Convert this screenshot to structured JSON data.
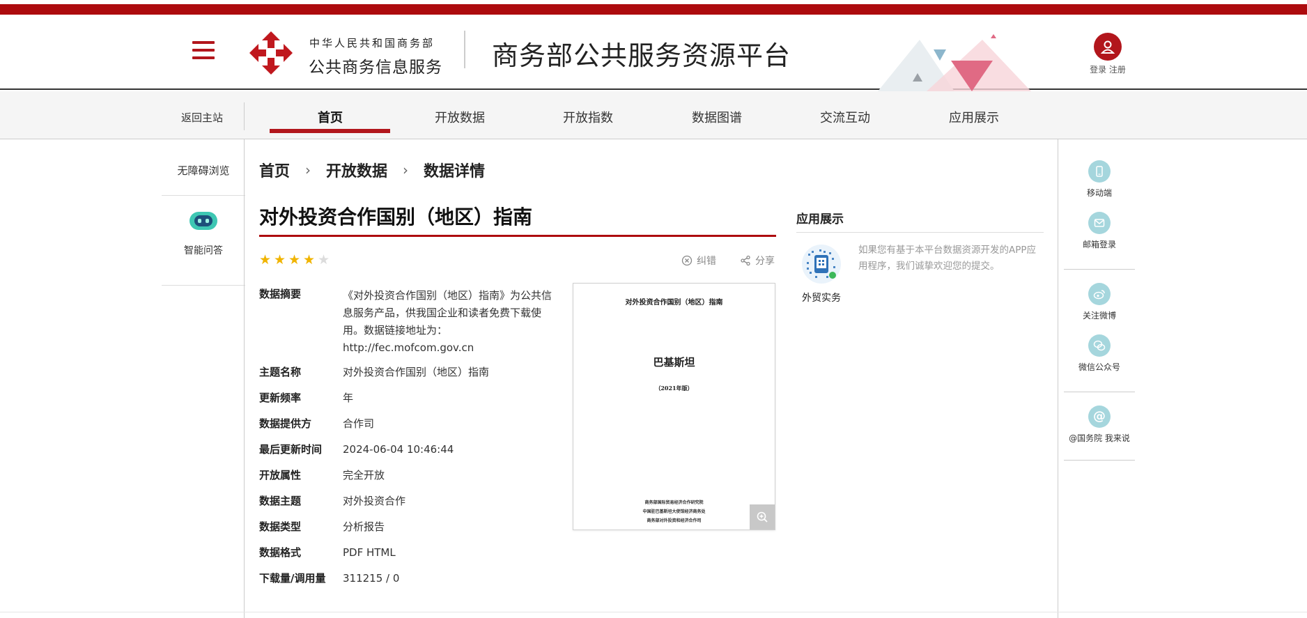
{
  "header": {
    "org_name": "中华人民共和国商务部",
    "org_sub": "公共商务信息服务",
    "platform_title": "商务部公共服务资源平台",
    "login": "登录",
    "register": "注册"
  },
  "nav": {
    "back_home": "返回主站",
    "items": [
      "首页",
      "开放数据",
      "开放指数",
      "数据图谱",
      "交流互动",
      "应用展示"
    ]
  },
  "left_rail": {
    "accessibility": "无障碍浏览",
    "assistant": "智能问答"
  },
  "breadcrumb": [
    "首页",
    "开放数据",
    "数据详情"
  ],
  "dataset": {
    "title": "对外投资合作国别（地区）指南",
    "rating": 4,
    "rating_max": 5,
    "correct_label": "纠错",
    "share_label": "分享",
    "fields": [
      {
        "key": "数据摘要",
        "value": "《对外投资合作国别（地区）指南》为公共信息服务产品，供我国企业和读者免费下载使用。数据链接地址为：http://fec.mofcom.gov.cn"
      },
      {
        "key": "主题名称",
        "value": "对外投资合作国别（地区）指南"
      },
      {
        "key": "更新频率",
        "value": "年"
      },
      {
        "key": "数据提供方",
        "value": "合作司"
      },
      {
        "key": "最后更新时间",
        "value": "2024-06-04 10:46:44"
      },
      {
        "key": "开放属性",
        "value": "完全开放"
      },
      {
        "key": "数据主题",
        "value": "对外投资合作"
      },
      {
        "key": "数据类型",
        "value": "分析报告"
      },
      {
        "key": "数据格式",
        "value": "PDF HTML"
      },
      {
        "key": "下载量/调用量",
        "value": "311215 / 0"
      }
    ]
  },
  "preview": {
    "head": "对外投资合作国别（地区）指南",
    "country": "巴基斯坦",
    "edition": "（2021年版）",
    "foot": [
      "商务部国际贸易经济合作研究院",
      "中国驻巴基斯坦大使馆经济商务处",
      "商务部对外投资和经济合作司"
    ]
  },
  "apps": {
    "title": "应用展示",
    "app_name": "外贸实务",
    "description": "如果您有基于本平台数据资源开发的APP应用程序，我们诚挚欢迎您的提交。"
  },
  "right_rail": [
    "移动端",
    "邮箱登录",
    "关注微博",
    "微信公众号",
    "@国务院 我来说"
  ],
  "colors": {
    "brand_red": "#ad0b0e",
    "star_gold": "#f0b400",
    "rail_teal": "#a5d6dd"
  }
}
